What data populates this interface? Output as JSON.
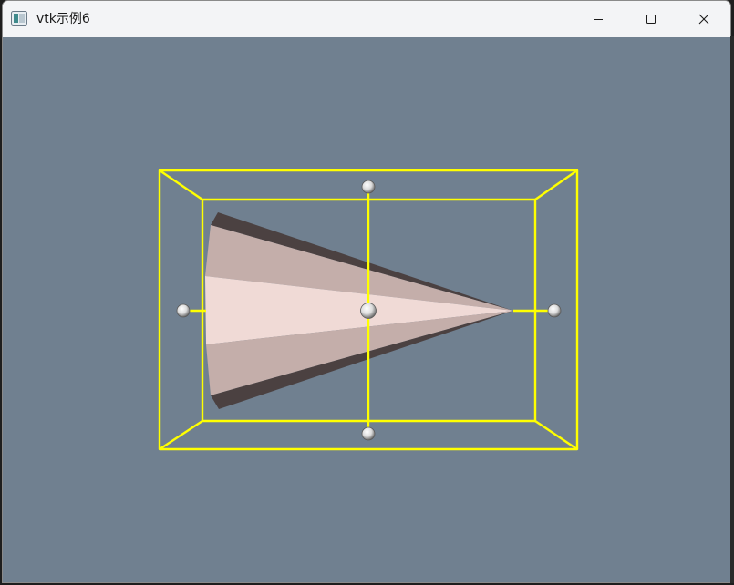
{
  "window": {
    "title": "vtk示例6",
    "icon": "vtk-app-icon"
  },
  "controls": {
    "minimize_icon": "minimize-icon",
    "maximize_icon": "maximize-icon",
    "close_icon": "close-icon"
  },
  "viewport": {
    "background_color": "#708090",
    "object": "cone",
    "widget": "box-widget",
    "widget_color": "#ffff00",
    "handle_color": "#ffffff"
  }
}
